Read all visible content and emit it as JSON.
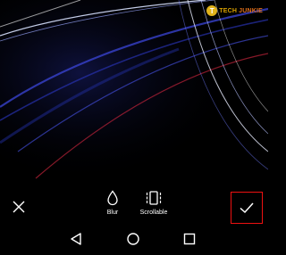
{
  "watermark": {
    "brand_part1": "TECH",
    "brand_part2": "JUNKIE",
    "logo_letter": "T"
  },
  "toolbar": {
    "close_icon": "close-icon",
    "blur": {
      "label": "Blur",
      "icon": "droplet-icon"
    },
    "scrollable": {
      "label": "Scrollable",
      "icon": "scroll-capture-icon"
    },
    "confirm_icon": "checkmark-icon",
    "confirm_highlight_color": "#e11111"
  },
  "navbar": {
    "back_icon": "triangle-back-icon",
    "home_icon": "circle-home-icon",
    "recents_icon": "square-recents-icon"
  },
  "colors": {
    "background": "#000000",
    "accent_blue": "#1a2a9a",
    "accent_red": "#c0243a"
  }
}
